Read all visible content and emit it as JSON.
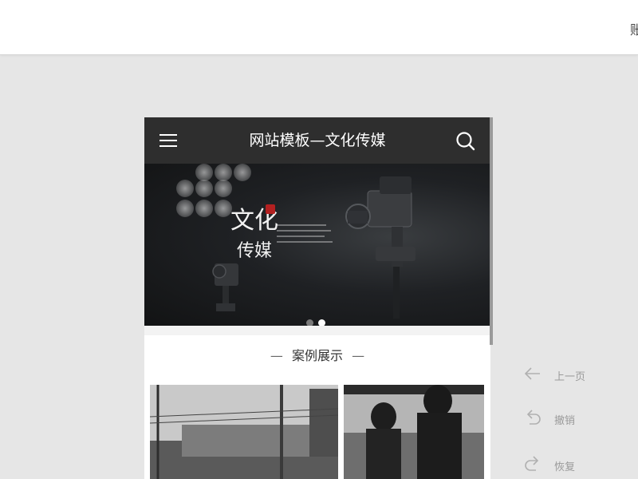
{
  "topbar": {
    "right_text": "账"
  },
  "phone": {
    "header": {
      "title": "网站模板—文化传媒",
      "menu_icon": "menu-icon",
      "search_icon": "search-icon"
    },
    "banner": {
      "logo_line1": "文化",
      "logo_line2": "传媒",
      "slides": 2,
      "active_slide": 2
    },
    "section": {
      "dash_left": "—",
      "title": "案例展示",
      "dash_right": "—"
    },
    "cases": [
      {
        "name": "train-station-photo"
      },
      {
        "name": "couple-photo"
      }
    ]
  },
  "tools": {
    "prev": {
      "label": "上一页",
      "icon": "arrow-left-icon"
    },
    "undo": {
      "label": "撤销",
      "icon": "undo-icon"
    },
    "redo": {
      "label": "恢复",
      "icon": "redo-icon"
    }
  },
  "colors": {
    "header_bg": "#2e2e2e",
    "page_bg": "#e6e6e6",
    "tool_text": "#9a9a9a"
  }
}
